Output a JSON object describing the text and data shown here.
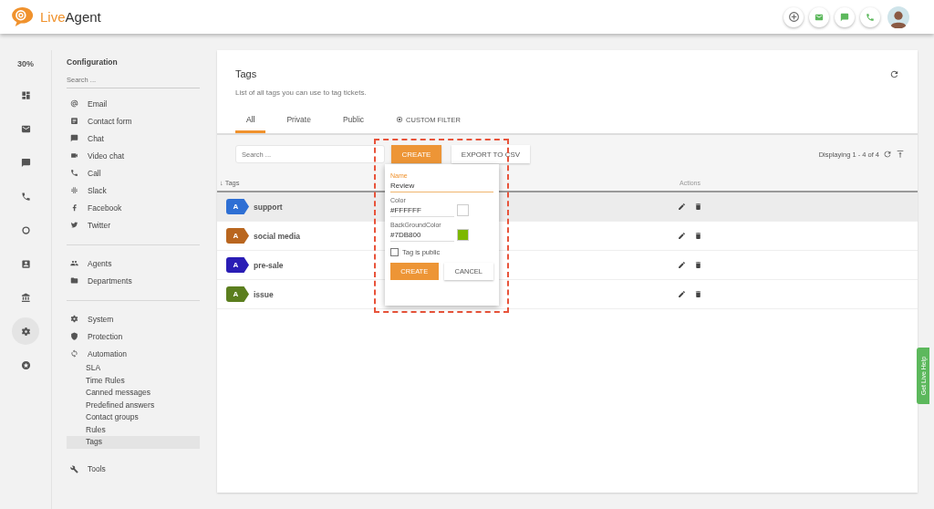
{
  "header": {
    "logo_first": "Live",
    "logo_second": "Agent",
    "actions": [
      {
        "kind": "add"
      },
      {
        "kind": "mail"
      },
      {
        "kind": "chat"
      },
      {
        "kind": "phone"
      }
    ]
  },
  "rail": {
    "percent": "30%",
    "items": [
      {
        "kind": "dashboard",
        "selected": false
      },
      {
        "kind": "mail",
        "selected": false
      },
      {
        "kind": "chat",
        "selected": false
      },
      {
        "kind": "phone",
        "selected": false
      },
      {
        "kind": "ring",
        "selected": false
      },
      {
        "kind": "contact",
        "selected": false
      },
      {
        "kind": "bank",
        "selected": false
      },
      {
        "kind": "gear",
        "selected": true
      },
      {
        "kind": "star",
        "selected": false
      }
    ]
  },
  "config": {
    "title": "Configuration",
    "search_placeholder": "Search ...",
    "groups": [
      [
        {
          "kind": "at",
          "label": "Email"
        },
        {
          "kind": "form",
          "label": "Contact form"
        },
        {
          "kind": "chat",
          "label": "Chat"
        },
        {
          "kind": "video",
          "label": "Video chat"
        },
        {
          "kind": "phone",
          "label": "Call"
        },
        {
          "kind": "slack",
          "label": "Slack"
        },
        {
          "kind": "facebook",
          "label": "Facebook"
        },
        {
          "kind": "twitter",
          "label": "Twitter"
        }
      ],
      [
        {
          "kind": "people",
          "label": "Agents"
        },
        {
          "kind": "folder",
          "label": "Departments"
        }
      ],
      [
        {
          "kind": "gear",
          "label": "System"
        },
        {
          "kind": "shield",
          "label": "Protection"
        },
        {
          "kind": "sync",
          "label": "Automation",
          "children": [
            {
              "label": "SLA",
              "selected": false
            },
            {
              "label": "Time Rules",
              "selected": false
            },
            {
              "label": "Canned messages",
              "selected": false
            },
            {
              "label": "Predefined answers",
              "selected": false
            },
            {
              "label": "Contact groups",
              "selected": false
            },
            {
              "label": "Rules",
              "selected": false
            },
            {
              "label": "Tags",
              "selected": true
            }
          ]
        }
      ],
      [
        {
          "kind": "wrench",
          "label": "Tools"
        }
      ]
    ]
  },
  "main": {
    "title": "Tags",
    "description": "List of all tags you can use to tag tickets.",
    "tabs": [
      {
        "label": "All",
        "selected": true
      },
      {
        "label": "Private",
        "selected": false
      },
      {
        "label": "Public",
        "selected": false
      }
    ],
    "custom_filter": "CUSTOM FILTER",
    "search_placeholder": "Search ...",
    "create_button": "CREATE",
    "export_button": "EXPORT TO CSV",
    "displaying": "Displaying 1 - 4 of 4",
    "columns": {
      "sort_mark": "↓",
      "tags": "Tags",
      "actions": "Actions"
    },
    "rows": [
      {
        "badge": "A",
        "name": "support",
        "color": "#2e6fd4",
        "highlighted": true
      },
      {
        "badge": "A",
        "name": "social media",
        "color": "#b9661f",
        "highlighted": false
      },
      {
        "badge": "A",
        "name": "pre-sale",
        "color": "#2a1db5",
        "highlighted": false
      },
      {
        "badge": "A",
        "name": "issue",
        "color": "#5b7e1e",
        "highlighted": false
      }
    ]
  },
  "popup": {
    "name_label": "Name",
    "name_value": "Review",
    "color_label": "Color",
    "color_value": "#FFFFFF",
    "bg_label": "BackGroundColor",
    "bg_value": "#7DB800",
    "public_label": "Tag is public",
    "public_checked": false,
    "create": "CREATE",
    "cancel": "CANCEL"
  },
  "live_help": "Get Live Help"
}
